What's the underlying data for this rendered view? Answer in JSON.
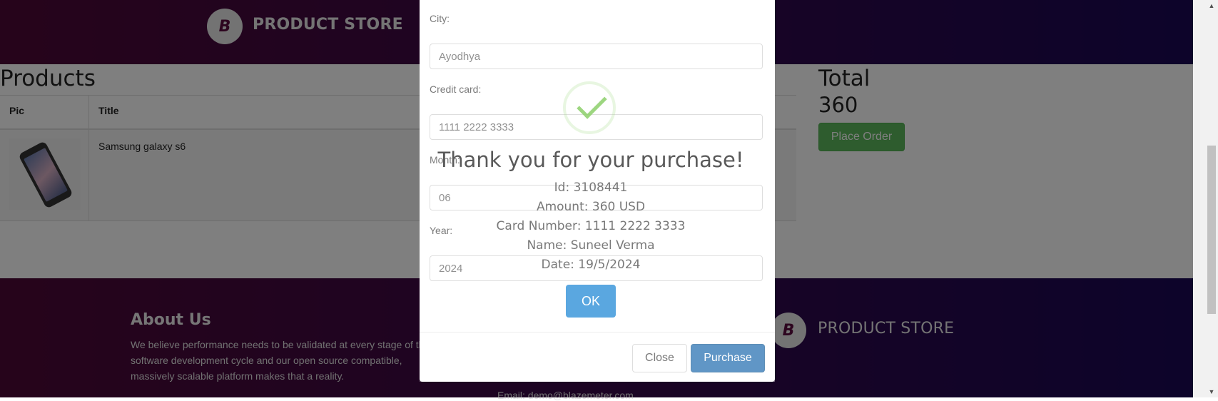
{
  "header": {
    "brand": "PRODUCT STORE",
    "logo_letter": "B"
  },
  "products": {
    "title": "Products",
    "columns": [
      "Pic",
      "Title"
    ],
    "rows": [
      {
        "title": "Samsung galaxy s6"
      }
    ]
  },
  "total": {
    "label": "Total",
    "value": "360",
    "place_order": "Place Order"
  },
  "footer": {
    "about_heading": "About Us",
    "about_text": "We believe performance needs to be validated at every stage of the software development cycle and our open source compatible, massively scalable platform makes that a reality.",
    "brand": "PRODUCT STORE",
    "email": "Email: demo@blazemeter.com"
  },
  "order_modal": {
    "city_label": "City:",
    "city_value": "Ayodhya",
    "card_label": "Credit card:",
    "card_value": "1111 2222 3333",
    "month_label": "Month:",
    "month_value": "06",
    "year_label": "Year:",
    "year_value": "2024",
    "close": "Close",
    "purchase": "Purchase"
  },
  "alert": {
    "title": "Thank you for your purchase!",
    "id": "Id: 3108441",
    "amount": "Amount: 360 USD",
    "card": "Card Number: 1111 2222 3333",
    "name": "Name: Suneel Verma",
    "date": "Date: 19/5/2024",
    "ok": "OK"
  },
  "icons": {
    "check": "check-icon",
    "phone": "phone-image"
  },
  "colors": {
    "header_start": "#4d0836",
    "header_end": "#1a0855",
    "place_order": "#5cb85c",
    "purchase": "#0b5ea8",
    "ok": "#5aa7e0",
    "check": "#8ccf6a"
  }
}
